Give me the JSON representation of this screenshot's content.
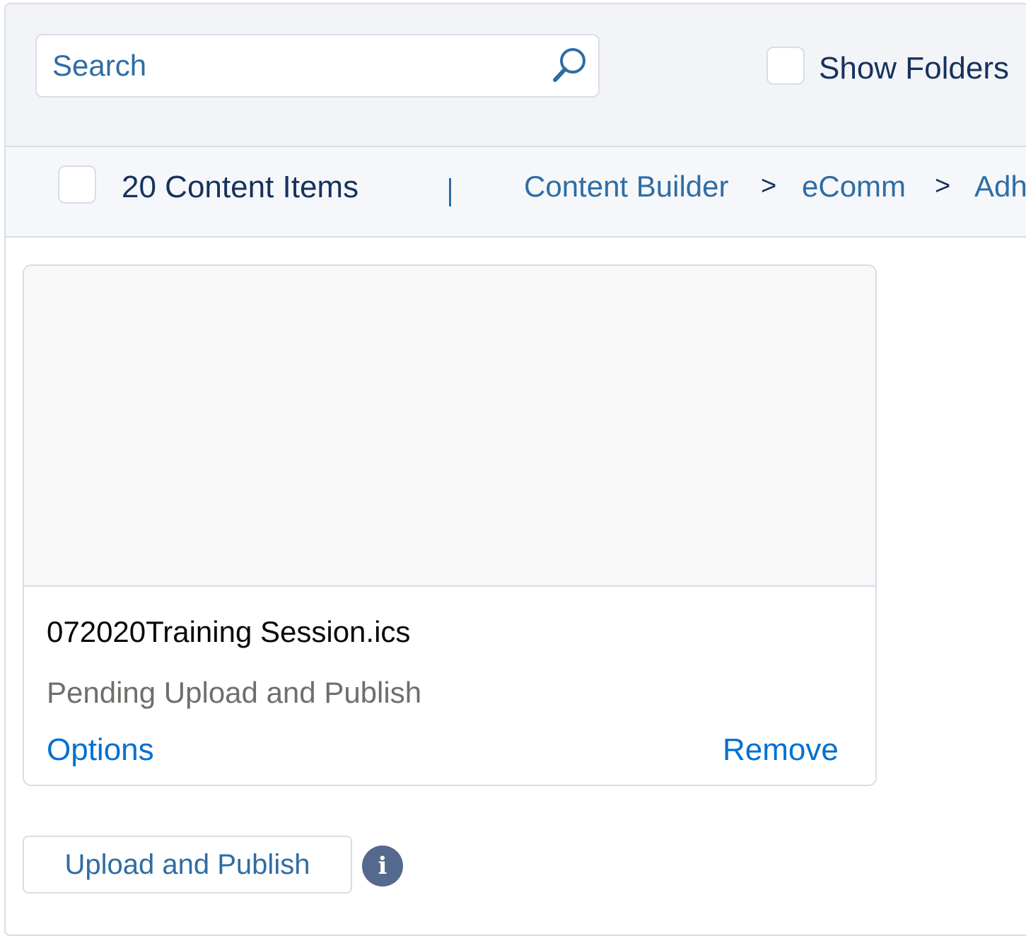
{
  "toolbar": {
    "search_placeholder": "Search",
    "search_value": "",
    "search_icon": "search-icon",
    "show_folders_label": "Show Folders",
    "show_folders_checked": false
  },
  "subheader": {
    "select_all_checked": false,
    "count_label": "20 Content Items",
    "separator": "|",
    "breadcrumb": [
      {
        "label": "Content Builder"
      },
      {
        "label": "eComm"
      },
      {
        "label": "Adh"
      }
    ],
    "breadcrumb_separator": ">"
  },
  "card": {
    "file_name": "072020Training Session.ics",
    "status": "Pending Upload and Publish",
    "options_label": "Options",
    "remove_label": "Remove"
  },
  "footer": {
    "upload_button_label": "Upload and Publish",
    "info_icon": "info-icon",
    "info_glyph": "i"
  }
}
